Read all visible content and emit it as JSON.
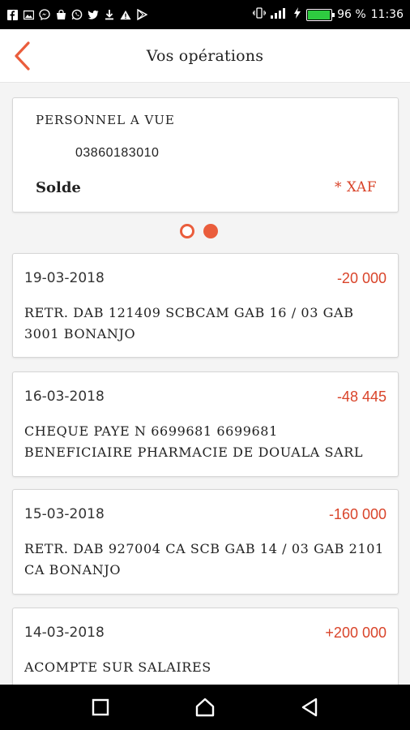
{
  "status_bar": {
    "battery_percent": "96 %",
    "battery_level": 0.96,
    "time": "11:36",
    "left_icons": [
      "facebook-icon",
      "image-icon",
      "messenger-icon",
      "shop-icon",
      "whatsapp-icon",
      "twitter-icon",
      "download-icon",
      "warning-icon",
      "play-store-icon"
    ],
    "right_icons": [
      "vibrate-icon",
      "signal-icon",
      "charging-icon",
      "battery-icon"
    ]
  },
  "header": {
    "title": "Vos opérations"
  },
  "account": {
    "name": "PERSONNEL A VUE",
    "number": "03860183010",
    "balance_label": "Solde",
    "balance_value": "* XAF"
  },
  "pager": {
    "count": 2,
    "active": 1
  },
  "operations": [
    {
      "date": "19-03-2018",
      "amount": "-20 000",
      "label": "RETR. DAB  121409 SCBCAM GAB 16 / 03 GAB 3001 BONANJO"
    },
    {
      "date": "16-03-2018",
      "amount": "-48 445",
      "label": "CHEQUE PAYE N  6699681 6699681 BENEFICIAIRE PHARMACIE DE DOUALA  SARL"
    },
    {
      "date": "15-03-2018",
      "amount": "-160 000",
      "label": "RETR. DAB  927004 CA SCB GAB 14 / 03 GAB 2101 CA BONANJO"
    },
    {
      "date": "14-03-2018",
      "amount": "+200 000",
      "label": "ACOMPTE SUR SALAIRES"
    }
  ],
  "nav": {
    "recents": "recents-icon",
    "home": "home-icon",
    "back": "back-icon"
  },
  "colors": {
    "accent": "#ea5d3c",
    "amount": "#d9442a",
    "battery": "#2ecc40"
  }
}
